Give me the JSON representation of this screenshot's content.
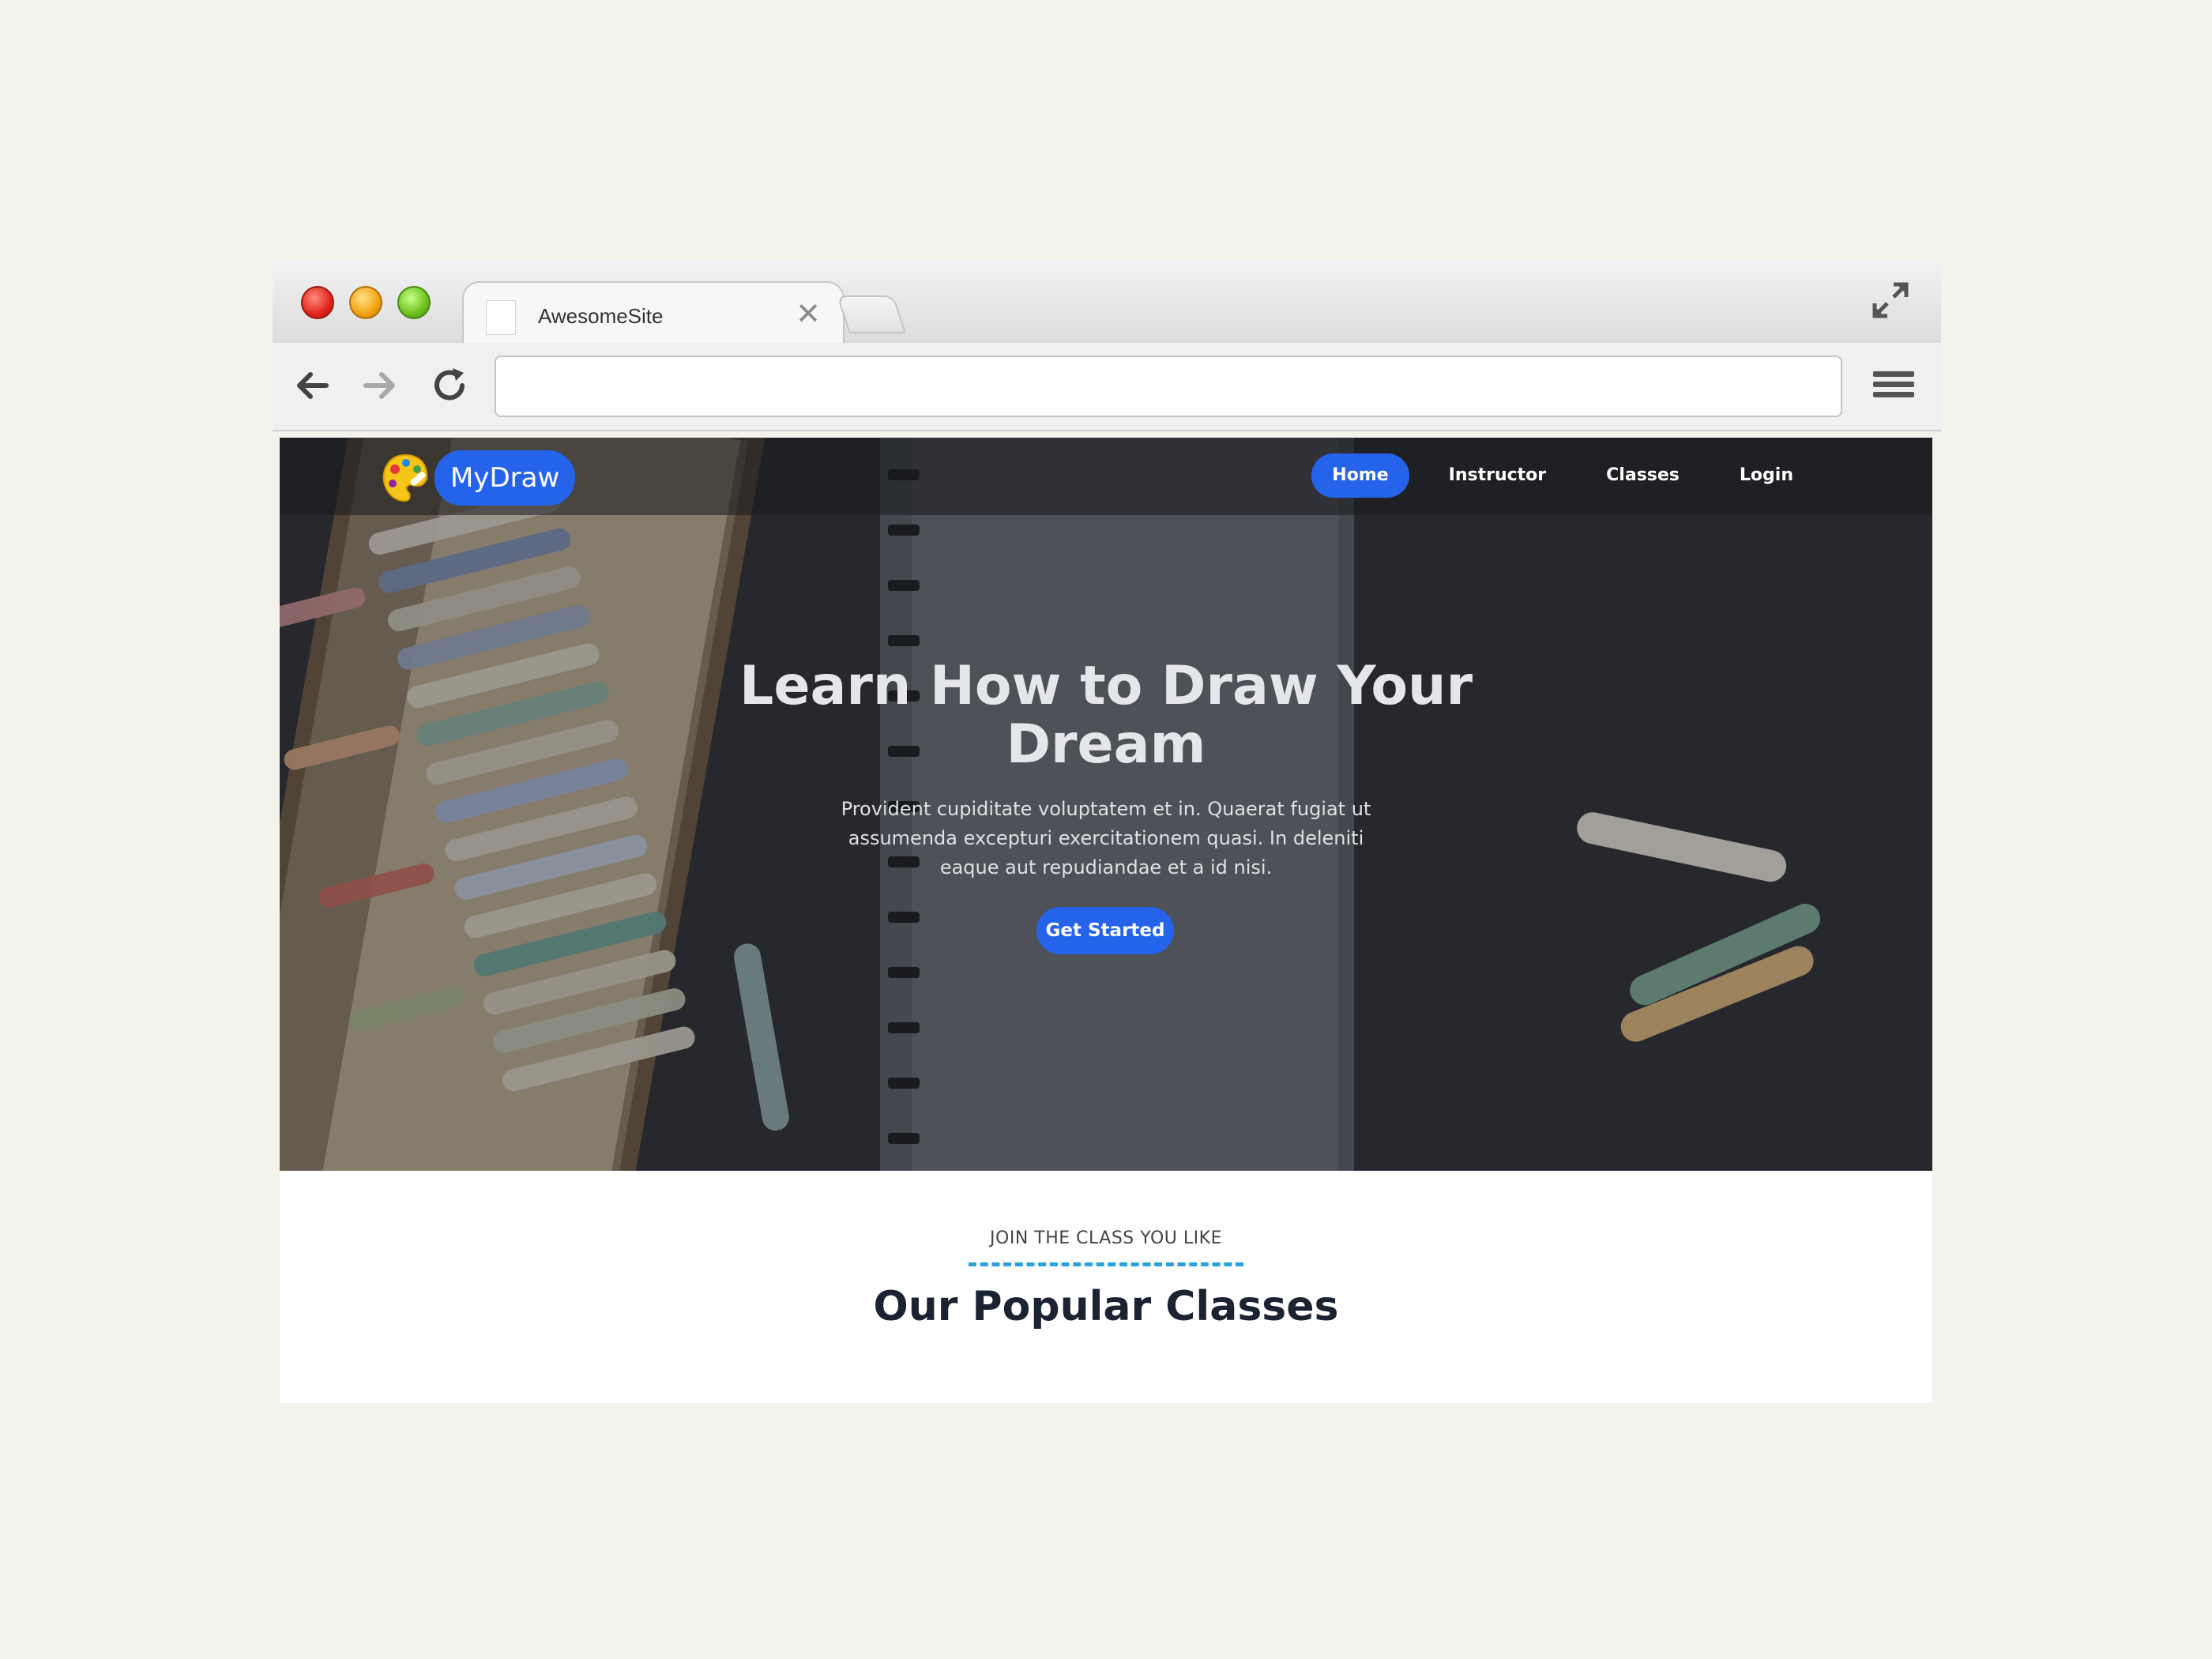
{
  "browser": {
    "tab_title": "AwesomeSite",
    "tab_close": "✕",
    "address_value": "",
    "address_placeholder": ""
  },
  "site": {
    "brand": "MyDraw",
    "nav": [
      {
        "label": "Home",
        "active": true
      },
      {
        "label": "Instructor",
        "active": false
      },
      {
        "label": "Classes",
        "active": false
      },
      {
        "label": "Login",
        "active": false
      }
    ]
  },
  "hero": {
    "title": "Learn How to Draw Your Dream",
    "subtitle": "Provident cupiditate voluptatem et in. Quaerat fugiat ut assumenda excepturi exercitationem quasi. In deleniti eaque aut repudiandae et a id nisi.",
    "cta_label": "Get Started"
  },
  "section": {
    "kicker": "JOIN THE CLASS YOU LIKE",
    "title": "Our Popular Classes"
  },
  "icons": {
    "close": "close-icon",
    "back": "arrow-left-icon",
    "forward": "arrow-right-icon",
    "reload": "reload-icon",
    "menu": "hamburger-menu-icon",
    "expand": "expand-icon",
    "logo": "palette-icon"
  },
  "colors": {
    "accent": "#2563eb",
    "kicker_line": "#27a2dc",
    "page_background": "#f3f3ec",
    "section_title": "#1b2333"
  }
}
